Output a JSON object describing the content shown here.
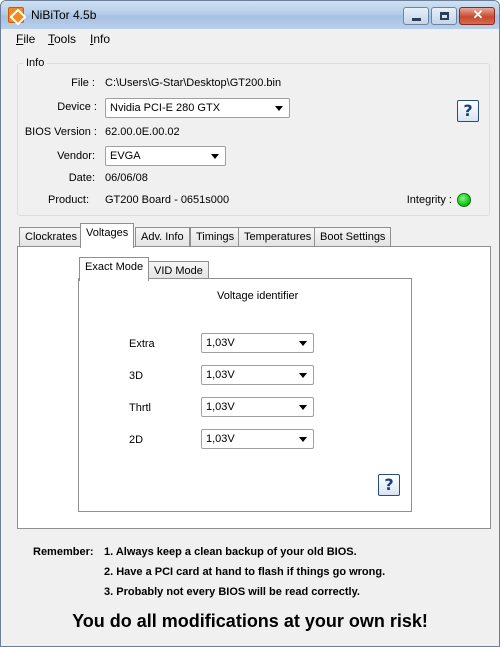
{
  "window": {
    "title": "NiBiTor 4.5b",
    "close_glyph": "✕"
  },
  "menu": {
    "file": "File",
    "tools": "Tools",
    "info": "Info"
  },
  "info": {
    "legend": "Info",
    "file_label": "File :",
    "file_value": "C:\\Users\\G-Star\\Desktop\\GT200.bin",
    "device_label": "Device :",
    "device_value": "Nvidia PCI-E 280 GTX",
    "bios_label": "BIOS Version :",
    "bios_value": "62.00.0E.00.02",
    "vendor_label": "Vendor:",
    "vendor_value": "EVGA",
    "date_label": "Date:",
    "date_value": "06/06/08",
    "product_label": "Product:",
    "product_value": "GT200 Board - 0651s000",
    "integrity_label": "Integrity :",
    "integrity_color": "#22c322"
  },
  "tabs": [
    "Clockrates",
    "Voltages",
    "Adv. Info",
    "Timings",
    "Temperatures",
    "Boot Settings"
  ],
  "active_tab": "Voltages",
  "voltages": {
    "subtabs": [
      "Exact Mode",
      "VID Mode"
    ],
    "active_subtab": "Exact Mode",
    "heading": "Voltage identifier",
    "rows": [
      {
        "label": "Extra",
        "value": "1,03V"
      },
      {
        "label": "3D",
        "value": "1,03V"
      },
      {
        "label": "Thrtl",
        "value": "1,03V"
      },
      {
        "label": "2D",
        "value": "1,03V"
      }
    ]
  },
  "help_glyph": "?",
  "footer": {
    "remember_label": "Remember:",
    "items": [
      "1. Always keep a clean backup of your old BIOS.",
      "2. Have a PCI card at hand to flash if things go wrong.",
      "3. Probably not every BIOS will be read correctly."
    ],
    "risk": "You do all modifications at your own risk!"
  },
  "icons": {
    "app": "nibitor-app-icon",
    "help": "help-question-icon",
    "dropdown": "chevron-down-icon",
    "integrity": "status-led-icon"
  }
}
